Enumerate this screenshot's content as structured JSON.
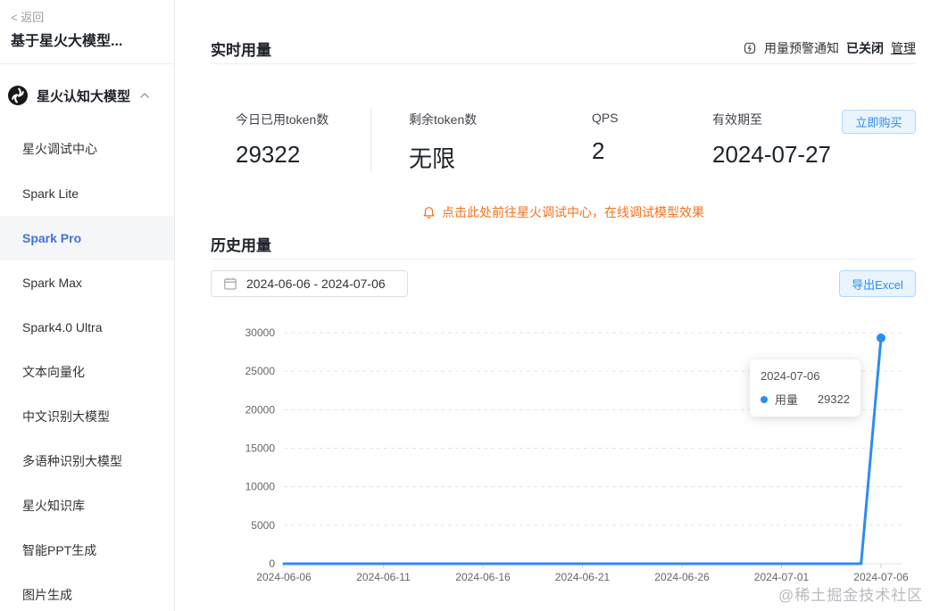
{
  "sidebar": {
    "back": "< 返回",
    "title": "基于星火大模型...",
    "group": {
      "label": "星火认知大模型"
    },
    "items": [
      {
        "label": "星火调试中心",
        "active": false
      },
      {
        "label": "Spark Lite",
        "active": false
      },
      {
        "label": "Spark Pro",
        "active": true
      },
      {
        "label": "Spark Max",
        "active": false
      },
      {
        "label": "Spark4.0 Ultra",
        "active": false
      },
      {
        "label": "文本向量化",
        "active": false
      },
      {
        "label": "中文识别大模型",
        "active": false
      },
      {
        "label": "多语种识别大模型",
        "active": false
      },
      {
        "label": "星火知识库",
        "active": false
      },
      {
        "label": "智能PPT生成",
        "active": false
      },
      {
        "label": "图片生成",
        "active": false
      }
    ]
  },
  "realtime": {
    "title": "实时用量",
    "alert": {
      "icon": "alarm-icon",
      "label": "用量预警通知",
      "status": "已关闭",
      "manage": "管理"
    },
    "stats": [
      {
        "label": "今日已用token数",
        "value": "29322"
      },
      {
        "label": "剩余token数",
        "value": "无限"
      },
      {
        "label": "QPS",
        "value": "2"
      },
      {
        "label": "有效期至",
        "value": "2024-07-27"
      }
    ],
    "buy_button": "立即购买",
    "notice": "点击此处前往星火调试中心，在线调试模型效果"
  },
  "history": {
    "title": "历史用量",
    "date_range": "2024-06-06  - 2024-07-06",
    "export_button": "导出Excel"
  },
  "tooltip": {
    "date": "2024-07-06",
    "series": "用量",
    "value": "29322"
  },
  "watermark": "@稀土掘金技术社区",
  "colors": {
    "accent_blue": "#2d8cf0",
    "active_item_blue": "#4272dd",
    "notice_orange": "#f5711d",
    "button_bg": "#e9f4ff",
    "grid": "#e6e6e6",
    "axis_text": "#666666"
  },
  "chart_data": {
    "type": "line",
    "series_name": "用量",
    "x": [
      "2024-06-06",
      "2024-06-07",
      "2024-06-08",
      "2024-06-09",
      "2024-06-10",
      "2024-06-11",
      "2024-06-12",
      "2024-06-13",
      "2024-06-14",
      "2024-06-15",
      "2024-06-16",
      "2024-06-17",
      "2024-06-18",
      "2024-06-19",
      "2024-06-20",
      "2024-06-21",
      "2024-06-22",
      "2024-06-23",
      "2024-06-24",
      "2024-06-25",
      "2024-06-26",
      "2024-06-27",
      "2024-06-28",
      "2024-06-29",
      "2024-06-30",
      "2024-07-01",
      "2024-07-02",
      "2024-07-03",
      "2024-07-04",
      "2024-07-05",
      "2024-07-06"
    ],
    "values": [
      0,
      0,
      0,
      0,
      0,
      0,
      0,
      0,
      0,
      0,
      0,
      0,
      0,
      0,
      0,
      0,
      0,
      0,
      0,
      0,
      0,
      0,
      0,
      0,
      0,
      0,
      0,
      0,
      0,
      0,
      29322
    ],
    "xticks": [
      "2024-06-06",
      "2024-06-11",
      "2024-06-16",
      "2024-06-21",
      "2024-06-26",
      "2024-07-01",
      "2024-07-06"
    ],
    "yticks": [
      0,
      5000,
      10000,
      15000,
      20000,
      25000,
      30000
    ],
    "ylim": [
      0,
      30000
    ],
    "grid": "dashed-horizontal",
    "legend": "none",
    "line_color": "#2d8cf0",
    "marker_last_point": true
  }
}
